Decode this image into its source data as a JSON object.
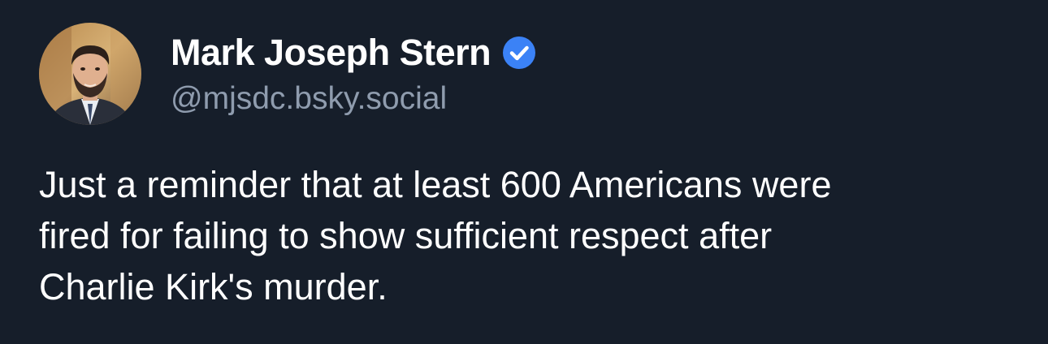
{
  "author": {
    "display_name": "Mark Joseph Stern",
    "handle": "@mjsdc.bsky.social",
    "verified": true,
    "verified_badge_color": "#3b82f6",
    "avatar_icon": "profile-photo"
  },
  "post": {
    "text_lines": [
      "Just a reminder that at least 600 Americans were",
      "fired for failing to show sufficient respect after",
      "Charlie Kirk's murder."
    ]
  },
  "theme": {
    "background": "#161e2a",
    "text_color": "#ffffff",
    "handle_color": "#8f9cae"
  }
}
